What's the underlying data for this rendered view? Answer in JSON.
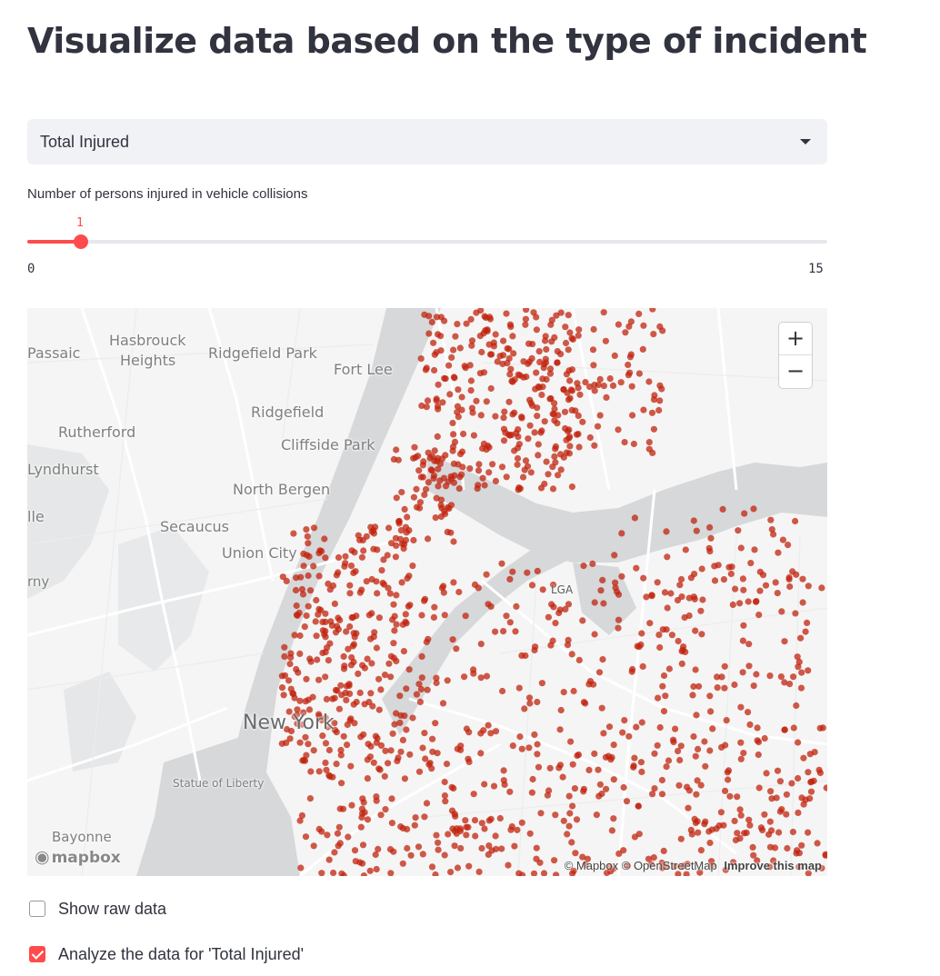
{
  "page": {
    "title": "Visualize data based on the type of incident"
  },
  "select": {
    "value": "Total Injured"
  },
  "slider": {
    "label": "Number of persons injured in vehicle collisions",
    "min": 0,
    "max": 15,
    "value": 1,
    "min_label": "0",
    "max_label": "15",
    "value_label": "1"
  },
  "map": {
    "labels": {
      "passaic": "Passaic",
      "hasbrouck1": "Hasbrouck",
      "hasbrouck2": "Heights",
      "ridgefield_park": "Ridgefield Park",
      "fort_lee": "Fort Lee",
      "ridgefield": "Ridgefield",
      "rutherford": "Rutherford",
      "cliffside_park": "Cliffside Park",
      "lyndhurst": "Lyndhurst",
      "north_bergen": "North Bergen",
      "lle": "lle",
      "secaucus": "Secaucus",
      "union_city": "Union City",
      "rny": "rny",
      "lga": "LGA",
      "new_york": "New York",
      "statue_of_liberty": "Statue of Liberty",
      "bayonne": "Bayonne"
    },
    "zoom_in": "+",
    "zoom_out": "−",
    "logo": "mapbox",
    "attribution": "© Mapbox © OpenStreetMap",
    "improve": "Improve this map",
    "point_color": "#c0230e"
  },
  "checkboxes": {
    "raw": {
      "label": "Show raw data",
      "checked": false
    },
    "analyze": {
      "label": "Analyze the data for 'Total Injured'",
      "checked": true
    }
  },
  "colors": {
    "accent": "#ff4b4b",
    "text": "#31333f",
    "select_bg": "#f0f2f6"
  }
}
